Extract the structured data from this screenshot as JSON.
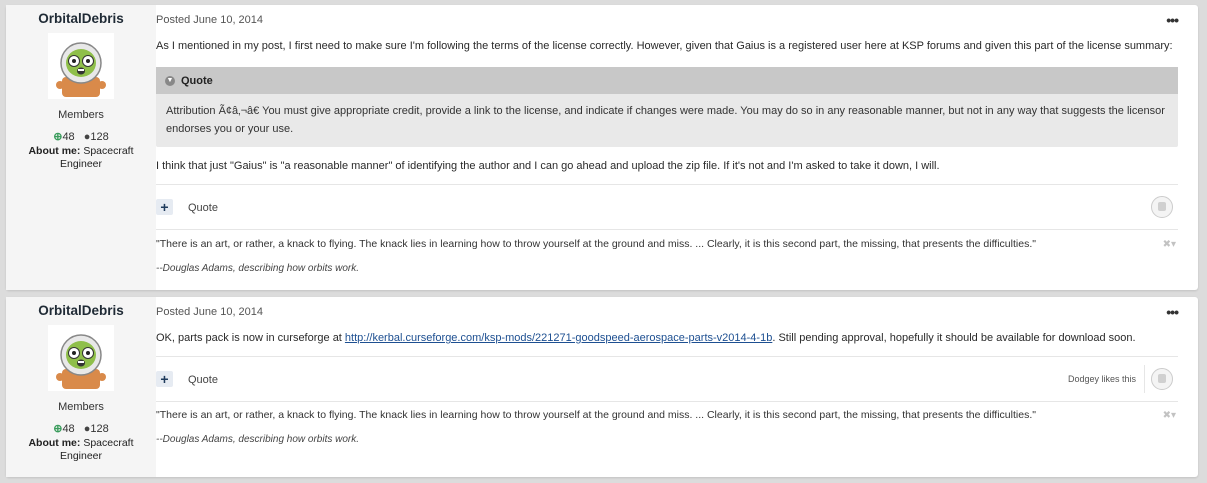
{
  "posts": [
    {
      "author": "OrbitalDebris",
      "role": "Members",
      "reputation": "48",
      "post_count": "128",
      "about_label": "About me:",
      "about_value": "Spacecraft Engineer",
      "posted": "Posted June 10, 2014",
      "paragraph1": "As I mentioned in my post, I first need to make sure I'm following the terms of the license correctly. However, given that Gaius is a registered user here at KSP forums and given this part of the license summary:",
      "quote_label": "Quote",
      "quote_text": "Attribution Ã¢â‚¬â€ You must give appropriate credit, provide a link to the license, and indicate if changes were made. You may do so in any reasonable manner, but not in any way that suggests the licensor endorses you or your use.",
      "paragraph2": "I think that just \"Gaius\" is \"a reasonable manner\" of identifying the author and I can go ahead and upload the zip file. If it's not and I'm asked to take it down, I will.",
      "action_quote": "Quote",
      "signature_line1": "\"There is an art, or rather, a knack to flying. The knack lies in learning how to throw yourself at the ground and miss. ... Clearly, it is this second part, the missing, that presents the difficulties.\"",
      "signature_line2": "--Douglas Adams, describing how orbits work."
    },
    {
      "author": "OrbitalDebris",
      "role": "Members",
      "reputation": "48",
      "post_count": "128",
      "about_label": "About me:",
      "about_value": "Spacecraft Engineer",
      "posted": "Posted June 10, 2014",
      "text_before": "OK, parts pack is now in curseforge at ",
      "link": "http://kerbal.curseforge.com/ksp-mods/221271-goodspeed-aerospace-parts-v2014-4-1b",
      "text_after": ". Still pending approval, hopefully it should be available for download soon.",
      "action_quote": "Quote",
      "likes_text": "Dodgey likes this",
      "signature_line1": "\"There is an art, or rather, a knack to flying. The knack lies in learning how to throw yourself at the ground and miss. ... Clearly, it is this second part, the missing, that presents the difficulties.\"",
      "signature_line2": "--Douglas Adams, describing how orbits work."
    }
  ],
  "icons": {
    "menu": "ellipsis-icon",
    "reputation": "plus-circle-icon",
    "posts": "speech-bubble-icon",
    "quote_collapse": "chevron-down-icon",
    "multiquote": "plus-icon",
    "like": "thumbs-up-icon",
    "signature_close": "close-icon"
  },
  "colors": {
    "page_bg": "#dcdcdc",
    "author_bg": "#f5f5f5",
    "quote_header": "#c8c8c8",
    "quote_body": "#e9e9e9",
    "link": "#1d4f91",
    "reputation": "#3a9c5c"
  }
}
